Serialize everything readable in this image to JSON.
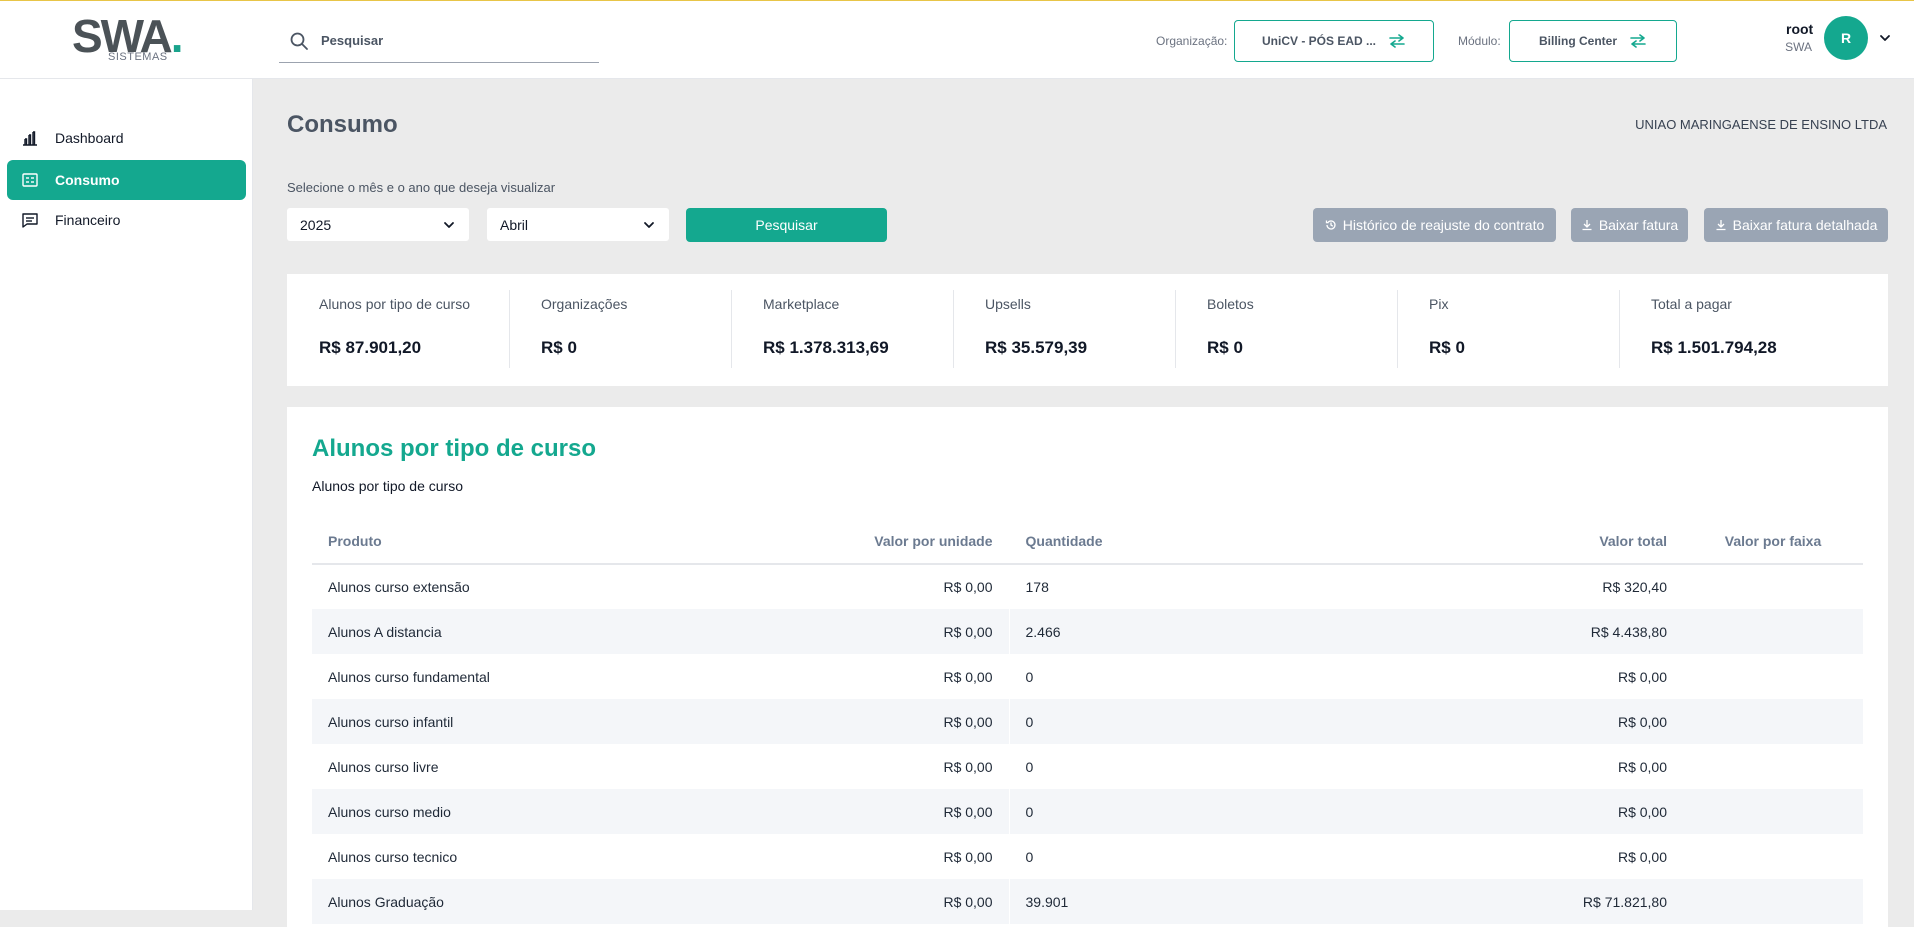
{
  "header": {
    "logo_text": "SWA",
    "logo_sub": "SISTEMAS",
    "search_placeholder": "Pesquisar",
    "org_label": "Organização:",
    "org_value": "UniCV - PÓS EAD ...",
    "module_label": "Módulo:",
    "module_value": "Billing Center",
    "user_name": "root",
    "user_org": "SWA",
    "avatar_initial": "R"
  },
  "sidebar": {
    "items": [
      {
        "label": "Dashboard",
        "icon": "bar-chart-icon",
        "active": false
      },
      {
        "label": "Consumo",
        "icon": "receipt-icon",
        "active": true
      },
      {
        "label": "Financeiro",
        "icon": "message-icon",
        "active": false
      }
    ]
  },
  "main": {
    "title": "Consumo",
    "company": "UNIAO MARINGAENSE DE ENSINO LTDA",
    "select_label": "Selecione o mês e o ano que deseja visualizar",
    "year": "2025",
    "month": "Abril",
    "search_button": "Pesquisar",
    "history_button": "Histórico de reajuste do contrato",
    "download_button": "Baixar fatura",
    "download_detailed_button": "Baixar fatura detalhada"
  },
  "summary": [
    {
      "label": "Alunos por tipo de curso",
      "value": "R$ 87.901,20"
    },
    {
      "label": "Organizações",
      "value": "R$ 0"
    },
    {
      "label": "Marketplace",
      "value": "R$ 1.378.313,69"
    },
    {
      "label": "Upsells",
      "value": "R$ 35.579,39"
    },
    {
      "label": "Boletos",
      "value": "R$ 0"
    },
    {
      "label": "Pix",
      "value": "R$ 0"
    },
    {
      "label": "Total a pagar",
      "value": "R$ 1.501.794,28"
    }
  ],
  "table": {
    "title": "Alunos por tipo de curso",
    "subtitle": "Alunos por tipo de curso",
    "columns": [
      "Produto",
      "Valor por unidade",
      "Quantidade",
      "Valor total",
      "Valor por faixa"
    ],
    "rows": [
      {
        "produto": "Alunos curso extensão",
        "valor_unidade": "R$ 0,00",
        "quantidade": "178",
        "valor_total": "R$ 320,40",
        "valor_faixa": ""
      },
      {
        "produto": "Alunos A distancia",
        "valor_unidade": "R$ 0,00",
        "quantidade": "2.466",
        "valor_total": "R$ 4.438,80",
        "valor_faixa": ""
      },
      {
        "produto": "Alunos curso fundamental",
        "valor_unidade": "R$ 0,00",
        "quantidade": "0",
        "valor_total": "R$ 0,00",
        "valor_faixa": ""
      },
      {
        "produto": "Alunos curso infantil",
        "valor_unidade": "R$ 0,00",
        "quantidade": "0",
        "valor_total": "R$ 0,00",
        "valor_faixa": ""
      },
      {
        "produto": "Alunos curso livre",
        "valor_unidade": "R$ 0,00",
        "quantidade": "0",
        "valor_total": "R$ 0,00",
        "valor_faixa": ""
      },
      {
        "produto": "Alunos curso medio",
        "valor_unidade": "R$ 0,00",
        "quantidade": "0",
        "valor_total": "R$ 0,00",
        "valor_faixa": ""
      },
      {
        "produto": "Alunos curso tecnico",
        "valor_unidade": "R$ 0,00",
        "quantidade": "0",
        "valor_total": "R$ 0,00",
        "valor_faixa": ""
      },
      {
        "produto": "Alunos Graduação",
        "valor_unidade": "R$ 0,00",
        "quantidade": "39.901",
        "valor_total": "R$ 71.821,80",
        "valor_faixa": ""
      }
    ]
  },
  "colors": {
    "accent": "#14a88f",
    "gray_button": "#9aa5b4",
    "background": "#ebebeb"
  }
}
